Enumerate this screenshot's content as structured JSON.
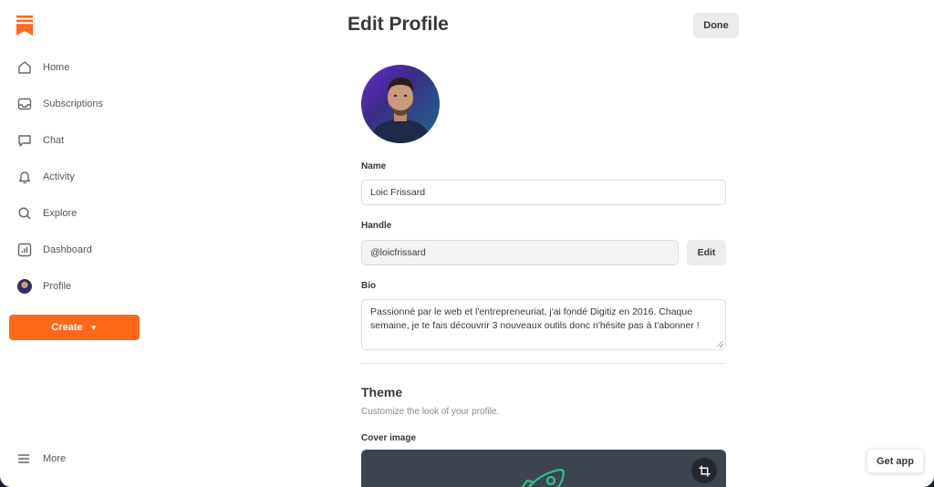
{
  "header": {
    "title": "Edit Profile",
    "done_label": "Done"
  },
  "sidebar": {
    "items": [
      {
        "label": "Home",
        "icon": "home-icon"
      },
      {
        "label": "Subscriptions",
        "icon": "inbox-icon"
      },
      {
        "label": "Chat",
        "icon": "chat-icon"
      },
      {
        "label": "Activity",
        "icon": "bell-icon"
      },
      {
        "label": "Explore",
        "icon": "search-icon"
      },
      {
        "label": "Dashboard",
        "icon": "chart-icon"
      },
      {
        "label": "Profile",
        "icon": "avatar"
      }
    ],
    "create_label": "Create",
    "more_label": "More"
  },
  "form": {
    "name_label": "Name",
    "name_value": "Loic Frissard",
    "handle_label": "Handle",
    "handle_value": "@loicfrissard",
    "edit_label": "Edit",
    "bio_label": "Bio",
    "bio_line1": "Passionné par le web et l'entrepreneuriat, j'ai fondé Digitiz en 2016. Chaque",
    "bio_line2": "semaine, je te fais découvrir 3 nouveaux outils donc n'hésite pas à t'abonner !"
  },
  "theme": {
    "title": "Theme",
    "subtitle": "Customize the look of your profile.",
    "cover_label": "Cover image"
  },
  "get_app_label": "Get app",
  "colors": {
    "accent": "#ff6719",
    "text": "#363737",
    "cover_bg": "#3c4450",
    "rocket": "#2bc48a"
  }
}
